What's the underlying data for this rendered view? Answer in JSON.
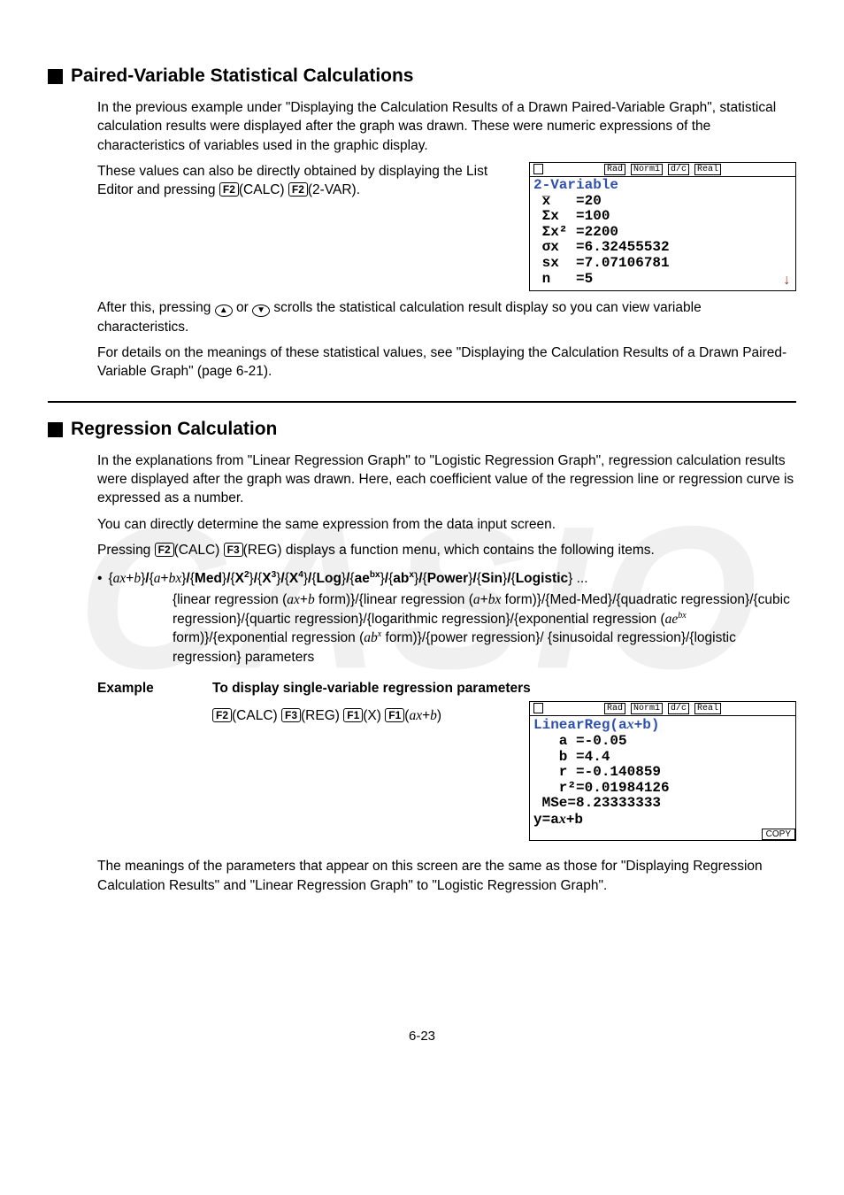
{
  "watermark": "CASIO",
  "section1": {
    "title": "Paired-Variable Statistical Calculations",
    "para1": "In the previous example under \"Displaying the Calculation Results of a Drawn Paired-Variable Graph\", statistical calculation results were displayed after the graph was drawn. These were numeric expressions of the characteristics of variables used in the graphic display.",
    "para2_pre": "These values can also be directly obtained by displaying the List Editor and pressing ",
    "para2_key1": "F2",
    "para2_key1_after": "(CALC)",
    "para2_key2": "F2",
    "para2_key2_after": "(2-VAR).",
    "para3": "After this, pressing     or     scrolls the statistical calculation result display so you can view variable characteristics.",
    "para4": "For details on the meanings of these statistical values, see \"Displaying the Calculation Results of a Drawn Paired-Variable Graph\" (page 6-21)."
  },
  "screen1": {
    "status": [
      "Rad",
      "Norm1",
      "d/c",
      "Real"
    ],
    "title": "2-Variable",
    "lines": [
      " x̅   =20",
      " Σx  =100",
      " Σx² =2200",
      " σx  =6.32455532",
      " sx  =7.07106781",
      " n   =5"
    ],
    "arrow": "↓"
  },
  "section2": {
    "title": "Regression Calculation",
    "para1": "In the explanations from \"Linear Regression Graph\" to \"Logistic Regression Graph\", regression calculation results were displayed after the graph was drawn. Here, each coefficient value of the regression line or regression curve is expressed as a number.",
    "para2": "You can directly determine the same expression from the data input screen.",
    "para3_pre": "Pressing ",
    "para3_mid": "(CALC)",
    "para3_post": "(REG) displays a function menu, which contains the following items.",
    "menu_opts_suffix": " ...",
    "menu_desc": "{linear regression (ax+b form)}/{linear regression (a+bx form)}/{Med-Med}/{quadratic regression}/{cubic regression}/{quartic regression}/{logarithmic regression}/{exponential regression (ae^{bx} form)}/{exponential regression (ab^{x} form)}/{power regression}/{sinusoidal regression}/{logistic regression} parameters",
    "example_label": "Example",
    "example_text": "To display single-variable regression parameters",
    "keysteps": {
      "k1": "F2",
      "t1": "(CALC)",
      "k2": "F3",
      "t2": "(REG)",
      "k3": "F1",
      "t3": "(X)",
      "k4": "F1",
      "t4_pre": "(",
      "t4_ital": "ax",
      "t4_plus": "+b)"
    },
    "para_last": "The meanings of the parameters that appear on this screen are the same as those for \"Displaying Regression Calculation Results\" and \"Linear Regression Graph\" to \"Logistic Regression Graph\"."
  },
  "screen2": {
    "status": [
      "Rad",
      "Norm1",
      "d/c",
      "Real"
    ],
    "title": "LinearReg(ax+b)",
    "lines": [
      "   a =-0.05",
      "   b =4.4",
      "   r =-0.140859",
      "   r²=0.01984126",
      " MSe=8.23333333",
      "y=ax+b"
    ],
    "copy": "COPY"
  },
  "pagenum": "6-23",
  "chart_data": {
    "screens": [
      {
        "type": "table",
        "title": "2-Variable",
        "rows": [
          {
            "label": "x̅",
            "value": 20
          },
          {
            "label": "Σx",
            "value": 100
          },
          {
            "label": "Σx²",
            "value": 2200
          },
          {
            "label": "σx",
            "value": 6.32455532
          },
          {
            "label": "sx",
            "value": 7.07106781
          },
          {
            "label": "n",
            "value": 5
          }
        ]
      },
      {
        "type": "table",
        "title": "LinearReg(ax+b)",
        "rows": [
          {
            "label": "a",
            "value": -0.05
          },
          {
            "label": "b",
            "value": 4.4
          },
          {
            "label": "r",
            "value": -0.140859
          },
          {
            "label": "r²",
            "value": 0.01984126
          },
          {
            "label": "MSe",
            "value": 8.23333333
          }
        ],
        "equation": "y=ax+b"
      }
    ]
  }
}
